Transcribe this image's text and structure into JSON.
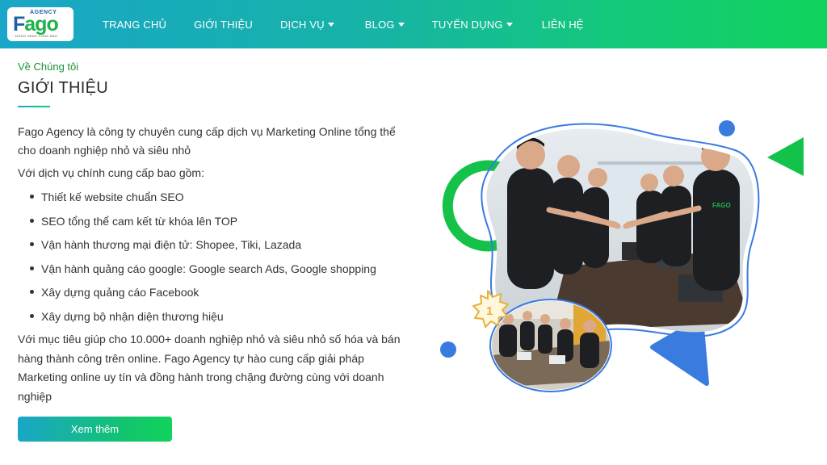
{
  "logo": {
    "agency": "AGENCY",
    "brand_first": "F",
    "brand_rest": "ago",
    "tagline": "ĐỒNG HÀNH CÙNG BẠN"
  },
  "nav": [
    {
      "label": "TRANG CHỦ",
      "dropdown": false
    },
    {
      "label": "GIỚI THIỆU",
      "dropdown": false
    },
    {
      "label": "DỊCH VỤ",
      "dropdown": true
    },
    {
      "label": "BLOG",
      "dropdown": true
    },
    {
      "label": "TUYỂN DỤNG",
      "dropdown": true
    },
    {
      "label": "LIÊN HỆ",
      "dropdown": false
    }
  ],
  "about": {
    "eyebrow": "Về Chúng tôi",
    "title": "GIỚI THIỆU",
    "intro": "Fago Agency là công ty chuyên cung cấp dịch vụ Marketing Online tổng thể cho doanh nghiệp nhỏ và siêu nhỏ",
    "services_heading": "Với dịch vụ chính cung cấp bao gồm:",
    "services": [
      "Thiết kế website chuẩn SEO",
      "SEO tổng thể cam kết từ khóa lên TOP",
      "Vận hành thương mại điện tử: Shopee, Tiki, Lazada",
      "Vận hành quảng cáo google: Google search Ads, Google shopping",
      "Xây dựng quảng cáo Facebook",
      "Xây dựng bộ nhận diện thương hiệu"
    ],
    "closing": "Với mục tiêu giúp cho 10.000+ doanh nghiệp nhỏ và siêu nhỏ số hóa và bán hàng thành công trên online. Fago Agency tự hào cung cấp giải pháp Marketing online uy tín và đồng hành trong chặng đường cùng với doanh nghiệp",
    "cta": "Xem thêm"
  },
  "illustration": {
    "badge": "1",
    "shirt_logo": "FAGO"
  },
  "colors": {
    "header_start": "#1aa6c8",
    "header_end": "#10d35c",
    "eyebrow": "#1e8f3c",
    "accent_blue": "#3a7be0",
    "accent_green": "#12c24a"
  }
}
